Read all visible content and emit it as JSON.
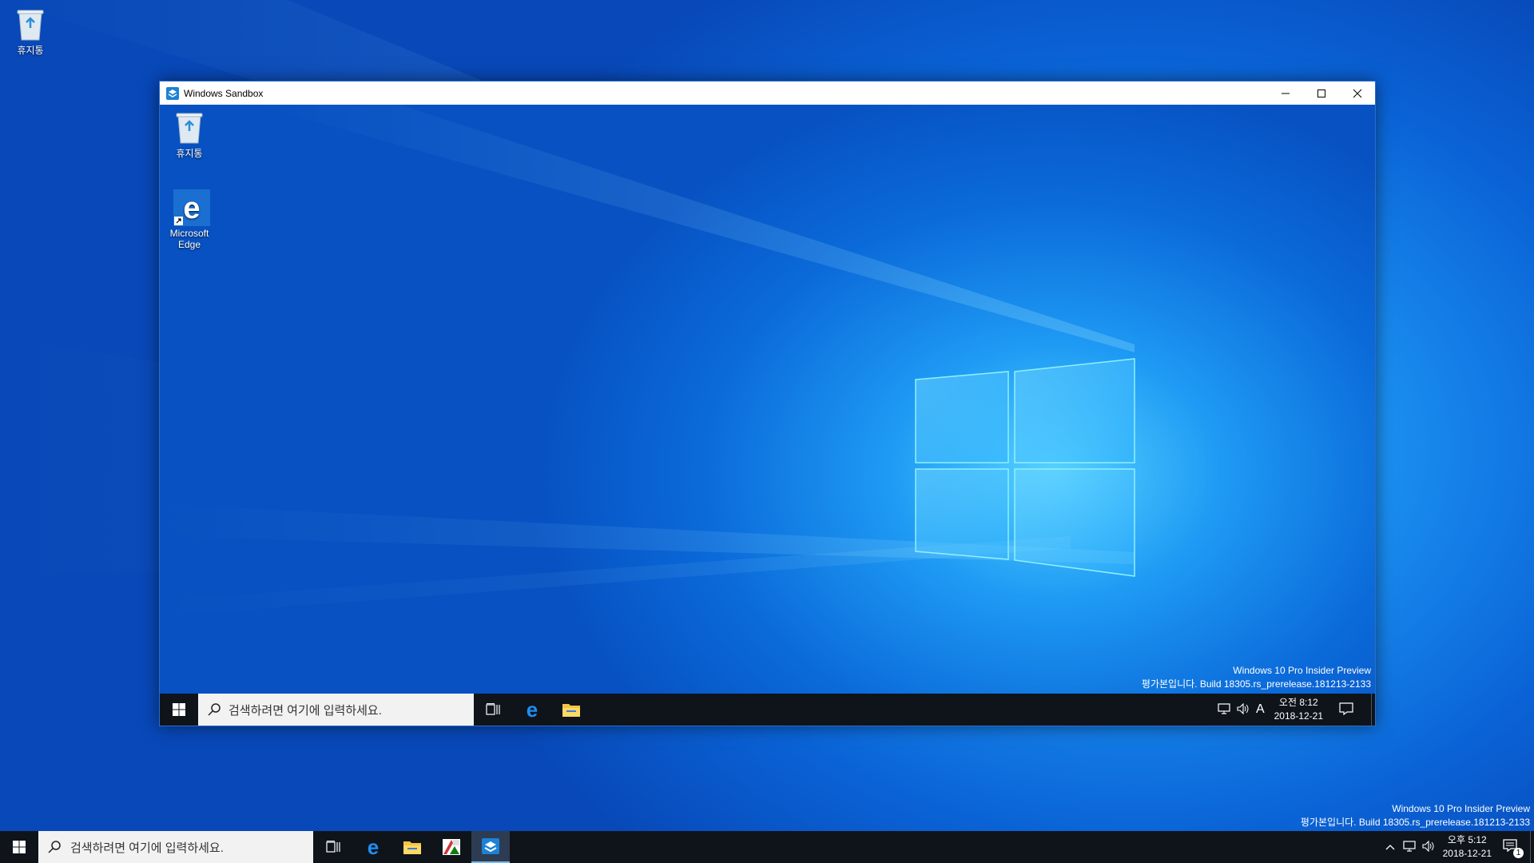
{
  "host": {
    "desktop_icons": [
      {
        "label": "휴지통",
        "icon": "recycle-bin-icon"
      }
    ],
    "watermark": {
      "line1": "Windows 10 Pro Insider Preview",
      "line2": "평가본입니다. Build 18305.rs_prerelease.181213-2133"
    },
    "taskbar": {
      "search_placeholder": "검색하려면 여기에 입력하세요.",
      "pinned": [
        "task-view-icon",
        "edge-icon",
        "file-explorer-icon",
        "office-icon",
        "windows-sandbox-icon"
      ],
      "clock_time": "오후 5:12",
      "clock_date": "2018-12-21",
      "notification_count": "1"
    }
  },
  "sandbox_window": {
    "title": "Windows Sandbox",
    "controls": [
      "minimize",
      "maximize",
      "close"
    ],
    "desktop_icons": [
      {
        "label": "휴지통",
        "icon": "recycle-bin-icon"
      },
      {
        "label": "Microsoft Edge",
        "icon": "edge-icon"
      }
    ],
    "watermark": {
      "line1": "Windows 10 Pro Insider Preview",
      "line2": "평가본입니다. Build 18305.rs_prerelease.181213-2133"
    },
    "taskbar": {
      "search_placeholder": "검색하려면 여기에 입력하세요.",
      "pinned": [
        "task-view-icon",
        "edge-icon",
        "file-explorer-icon"
      ],
      "ime_indicator": "A",
      "clock_time": "오전 8:12",
      "clock_date": "2018-12-21"
    }
  },
  "colors": {
    "accent": "#0078d7",
    "taskbar": "#0f141b",
    "active_task": "#2d3c52"
  }
}
